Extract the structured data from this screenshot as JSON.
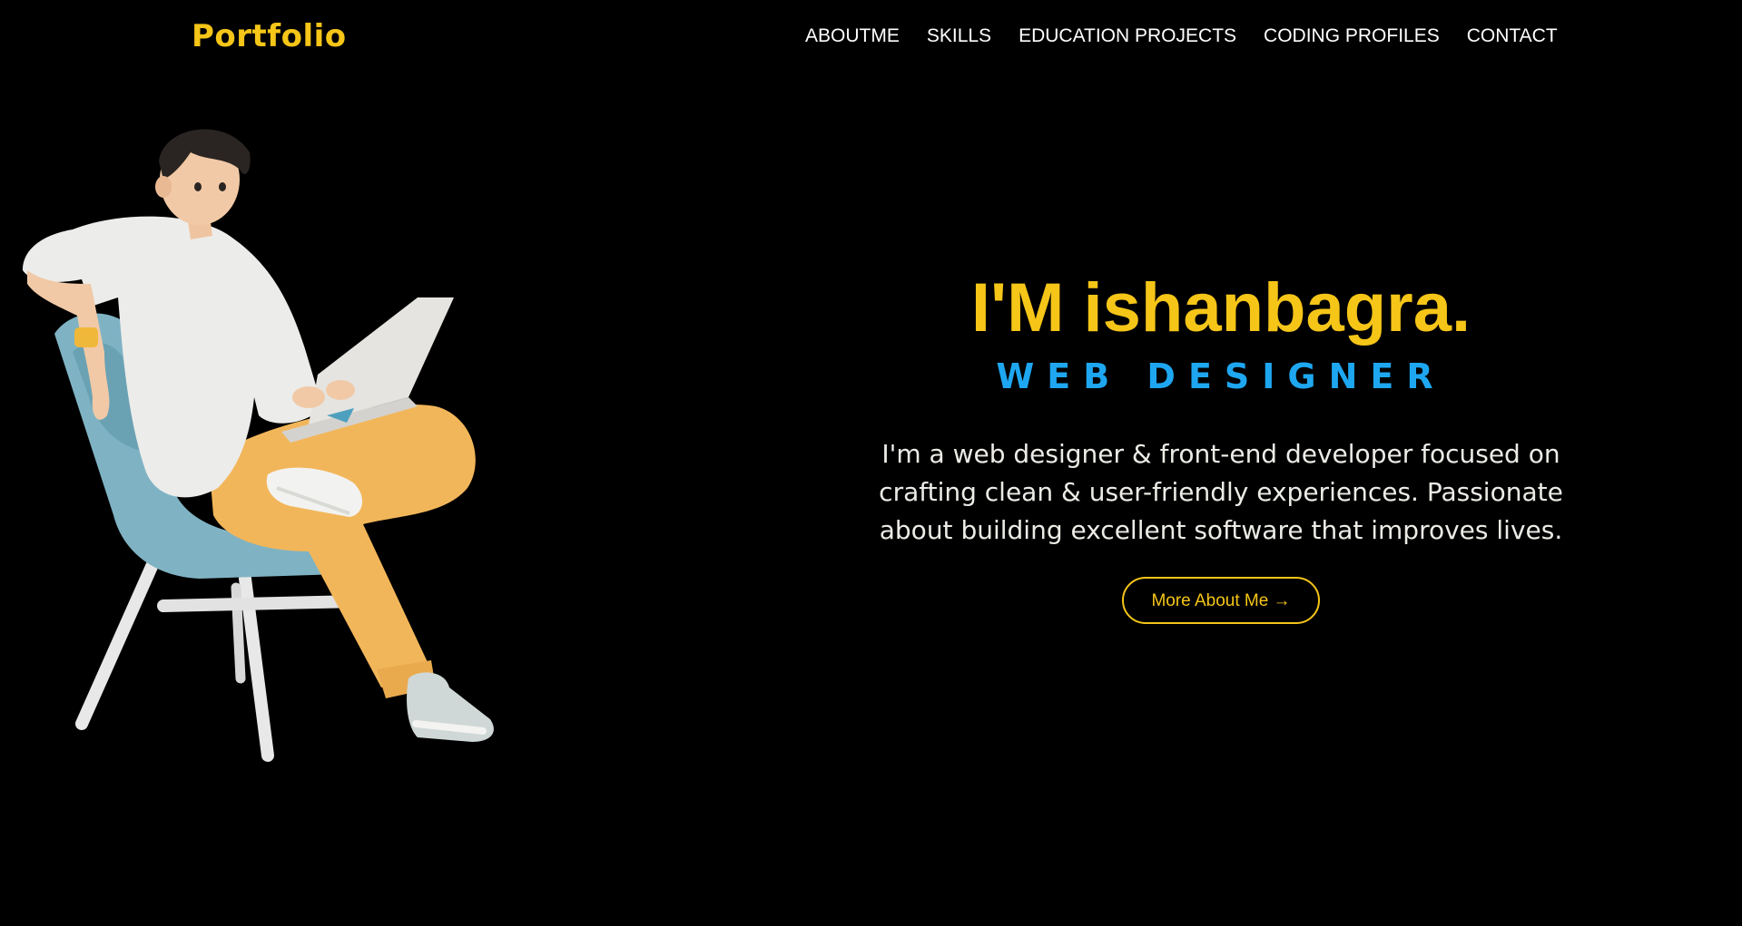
{
  "header": {
    "brand": "Portfolio",
    "nav": [
      {
        "label": "ABOUTME"
      },
      {
        "label": "SKILLS"
      },
      {
        "label": "EDUCATION PROJECTS"
      },
      {
        "label": "CODING PROFILES"
      },
      {
        "label": "CONTACT"
      }
    ]
  },
  "hero": {
    "title": "I'M ishanbagra.",
    "subtitle": "WEB DESIGNER",
    "description": "I'm a web designer & front-end developer focused on crafting clean & user-friendly experiences. Passionate about building excellent software that improves lives.",
    "cta_label": "More About Me →"
  },
  "illustration": {
    "icon": "person-on-chair-with-laptop-illustration"
  },
  "colors": {
    "background": "#000000",
    "accent_yellow": "#f5c518",
    "accent_blue": "#1ea7f0",
    "text": "#ffffff"
  }
}
